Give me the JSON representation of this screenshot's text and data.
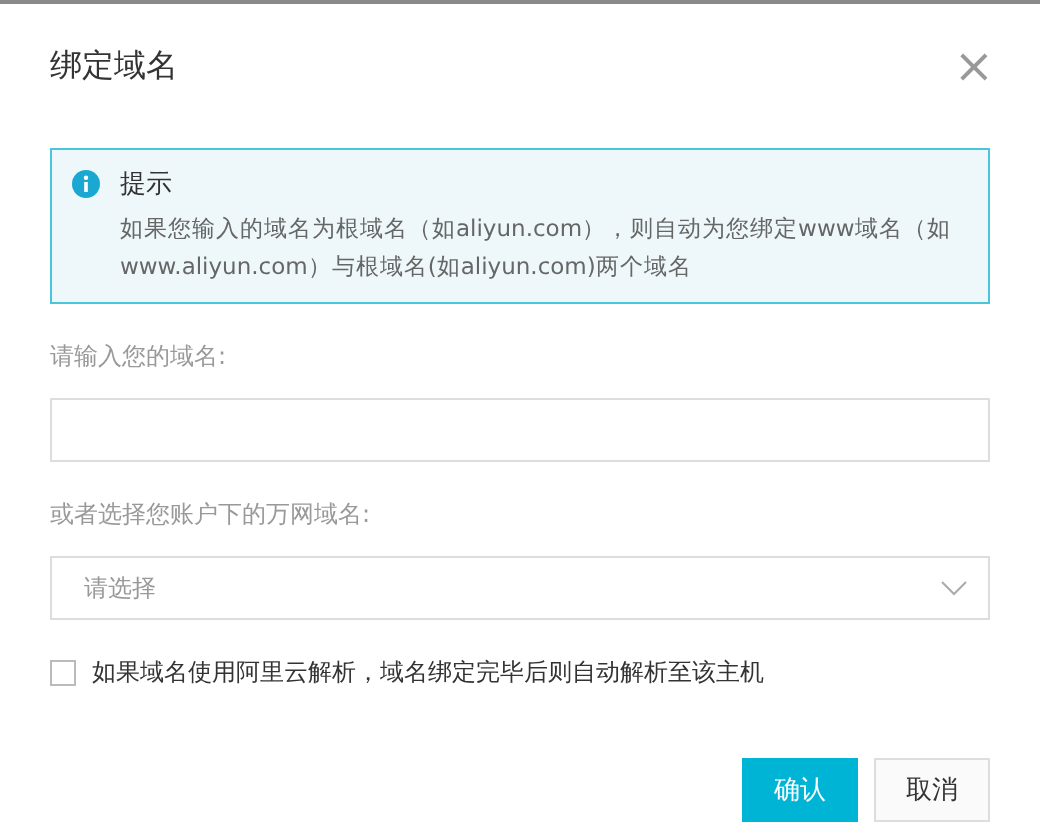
{
  "dialog": {
    "title": "绑定域名",
    "close": "×"
  },
  "notice": {
    "title": "提示",
    "body": "如果您输入的域名为根域名（如aliyun.com），则自动为您绑定www域名（如www.aliyun.com）与根域名(如aliyun.com)两个域名"
  },
  "domain_field": {
    "label": "请输入您的域名:"
  },
  "domain_select": {
    "label": "或者选择您账户下的万网域名:",
    "placeholder": "请选择"
  },
  "auto_resolve": {
    "label": "如果域名使用阿里云解析，域名绑定完毕后则自动解析至该主机",
    "checked": false
  },
  "buttons": [
    {
      "label": "确认",
      "kind": "primary"
    },
    {
      "label": "取消",
      "kind": "secondary"
    }
  ]
}
